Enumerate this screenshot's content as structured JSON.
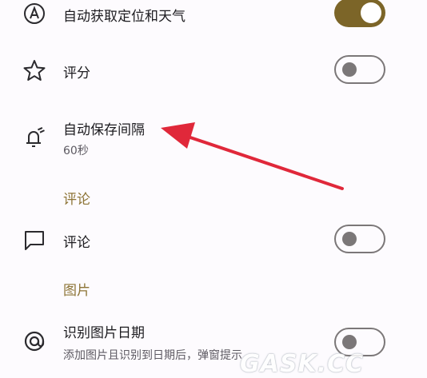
{
  "settings": {
    "auto_location": {
      "label": "自动获取定位和天气",
      "enabled": true
    },
    "rating": {
      "label": "评分",
      "enabled": false
    },
    "autosave": {
      "label": "自动保存间隔",
      "value": "60秒"
    },
    "comments_section": {
      "title": "评论"
    },
    "comments": {
      "label": "评论",
      "enabled": false
    },
    "images_section": {
      "title": "图片"
    },
    "image_date": {
      "label": "识别图片日期",
      "description": "添加图片且识别到日期后，弹窗提示",
      "enabled": false
    }
  },
  "watermark": "GASK.CC",
  "colors": {
    "accent": "#7c6528",
    "section_text": "#8d7436",
    "arrow": "#e0283a",
    "switch_off": "#7b7778"
  },
  "icons": [
    "auto-a-icon",
    "star-icon",
    "alarm-edit-icon",
    "comment-icon",
    "at-icon"
  ]
}
